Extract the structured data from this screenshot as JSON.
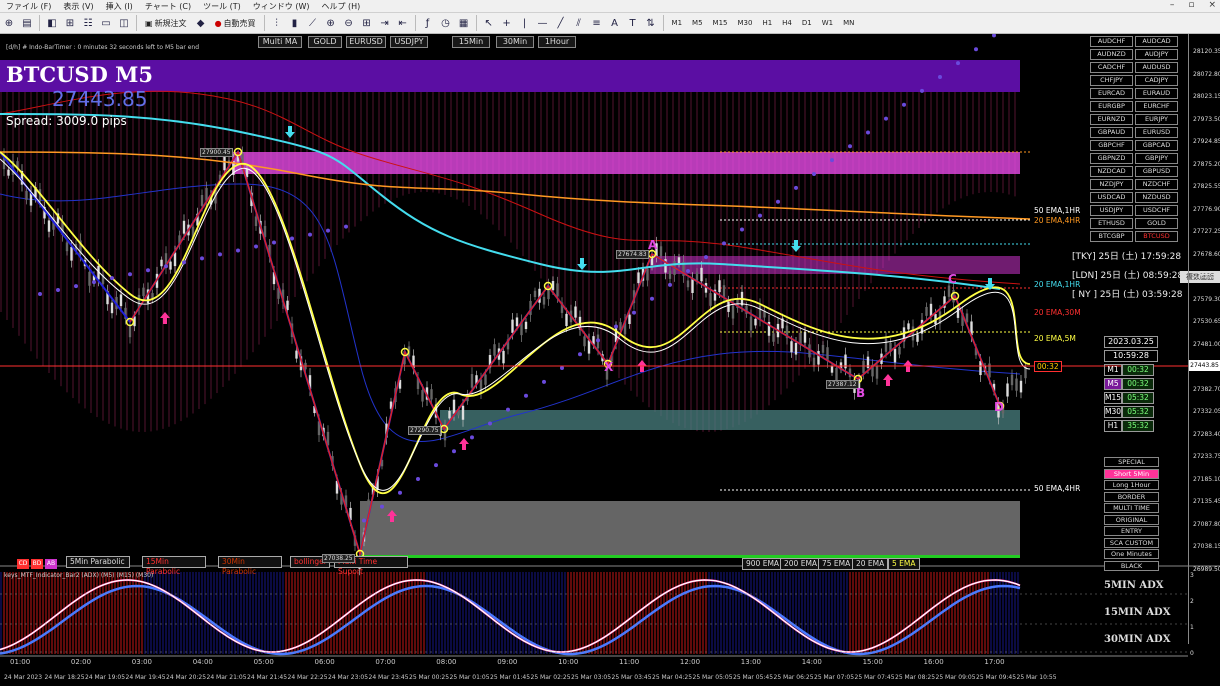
{
  "menu": [
    "ファイル (F)",
    "表示 (V)",
    "挿入 (I)",
    "チャート (C)",
    "ツール (T)",
    "ウィンドウ (W)",
    "ヘルプ (H)"
  ],
  "window_controls": [
    "–",
    "▫",
    "×"
  ],
  "toolbar": {
    "new_order": "新規注文",
    "auto_trade": "自動売買",
    "timeframes": [
      "M1",
      "M5",
      "M15",
      "M30",
      "H1",
      "H4",
      "D1",
      "W1",
      "MN"
    ],
    "text_tool": "A",
    "label_tool": "T"
  },
  "chart": {
    "timer_text": "[d/h] # Indo-BarTimer :  0 minutes 32 seconds left to M5 bar end",
    "symbol": "BTCUSD M5",
    "price_big": "27443.85",
    "spread": "Spread: 3009.0 pips",
    "top_tabs_left": [
      "Multi MA",
      "GOLD",
      "EURUSD",
      "USDJPY"
    ],
    "top_tabs_right": [
      "15Min",
      "30Min",
      "1Hour"
    ],
    "pairs": [
      [
        "AUDCHF",
        "AUDCAD"
      ],
      [
        "AUDNZD",
        "AUDJPY"
      ],
      [
        "CADCHF",
        "AUDUSD"
      ],
      [
        "CHFJPY",
        "CADJPY"
      ],
      [
        "EURCAD",
        "EURAUD"
      ],
      [
        "EURGBP",
        "EURCHF"
      ],
      [
        "EURNZD",
        "EURJPY"
      ],
      [
        "GBPAUD",
        "EURUSD"
      ],
      [
        "GBPCHF",
        "GBPCAD"
      ],
      [
        "GBPNZD",
        "GBPJPY"
      ],
      [
        "NZDCAD",
        "GBPUSD"
      ],
      [
        "NZDJPY",
        "NZDCHF"
      ],
      [
        "USDCAD",
        "NZDUSD"
      ],
      [
        "USDJPY",
        "USDCHF"
      ],
      [
        "ETHUSD",
        "GOLD"
      ],
      [
        "BTCGBP",
        "BTCUSD"
      ]
    ],
    "selected_pair": "BTCUSD",
    "sessions": [
      "[TKY] 25日 (土) 17:59:28",
      "[LDN] 25日 (土) 08:59:28",
      "[ NY ] 25日 (土) 03:59:28"
    ],
    "popup_btn": "複数画面",
    "ma_labels": [
      {
        "text": "50 EMA,1HR",
        "color": "#ffffff"
      },
      {
        "text": "20 EMA,4HR",
        "color": "#ff9922"
      },
      {
        "text": "20 EMA,1HR",
        "color": "#44ddee"
      },
      {
        "text": "20 EMA,30M",
        "color": "#ff3030"
      },
      {
        "text": "20 EMA,5M",
        "color": "#ffff44"
      },
      {
        "text": "50 EMA,4HR",
        "color": "#ffffff"
      }
    ],
    "clock": {
      "date": "2023.03.25",
      "time": "10:59:28"
    },
    "tf_timers": [
      {
        "tf": "M1",
        "val": "00:32"
      },
      {
        "tf": "M5",
        "val": "00:32"
      },
      {
        "tf": "M15",
        "val": "05:32"
      },
      {
        "tf": "M30",
        "val": "05:32"
      },
      {
        "tf": "H1",
        "val": "35:32"
      }
    ],
    "side_buttons": [
      "SPECIAL",
      "Short 5Min",
      "Long 1Hour",
      "BORDER",
      "MULTI TIME",
      "ORIGINAL",
      "ENTRY",
      "SCA CUSTOM",
      "One Minutes",
      "BLACK"
    ],
    "highlight_button": "Short 5Min",
    "price_axis": [
      "28120.35",
      "28072.80",
      "28023.15",
      "27973.50",
      "27924.85",
      "27875.20",
      "27825.55",
      "27776.90",
      "27727.25",
      "27678.60",
      "27628.95",
      "27579.30",
      "27530.65",
      "27481.00",
      "27431.35",
      "27382.70",
      "27332.05",
      "27283.40",
      "27233.75",
      "27185.10",
      "27135.45",
      "27087.80",
      "27038.15",
      "26989.50"
    ],
    "current_price": "27443.85",
    "countdown": "00:32",
    "bottom_left_tags": [
      "CD",
      "BD",
      "AB"
    ],
    "bottom_buttons": [
      "5Min Parabolic",
      "15Min Parabolic",
      "30Min Parabolic",
      "bollinger",
      "Multi Time Suport"
    ],
    "ema_buttons": [
      "900 EMA",
      "200 EMA",
      "75 EMA",
      "20 EMA",
      "5 EMA"
    ],
    "price_notes": [
      "27900.45",
      "27290.75",
      "27674.83",
      "27387.12",
      "27038.25"
    ],
    "wave_labels": [
      "A",
      "B",
      "C",
      "D",
      "X"
    ],
    "indicator_title": "keys_MTF_Indicator_Bar2 (ADX) (M5) (M15) (M30)",
    "adx_labels": [
      "5MIN ADX",
      "15MIN ADX",
      "30MIN ADX"
    ],
    "adx_axis": [
      "3",
      "2",
      "1",
      "0"
    ],
    "time_labels": [
      "01:00",
      "02:00",
      "03:00",
      "04:00",
      "05:00",
      "06:00",
      "07:00",
      "08:00",
      "09:00",
      "10:00",
      "11:00",
      "12:00",
      "13:00",
      "14:00",
      "15:00",
      "16:00",
      "17:00"
    ],
    "date_labels": [
      "24 Mar 2023",
      "24 Mar 18:25",
      "24 Mar 19:05",
      "24 Mar 19:45",
      "24 Mar 20:25",
      "24 Mar 21:05",
      "24 Mar 21:45",
      "24 Mar 22:25",
      "24 Mar 23:05",
      "24 Mar 23:45",
      "25 Mar 00:25",
      "25 Mar 01:05",
      "25 Mar 01:45",
      "25 Mar 02:25",
      "25 Mar 03:05",
      "25 Mar 03:45",
      "25 Mar 04:25",
      "25 Mar 05:05",
      "25 Mar 05:45",
      "25 Mar 06:25",
      "25 Mar 07:05",
      "25 Mar 07:45",
      "25 Mar 08:25",
      "25 Mar 09:05",
      "25 Mar 09:45",
      "25 Mar 10:55"
    ]
  }
}
